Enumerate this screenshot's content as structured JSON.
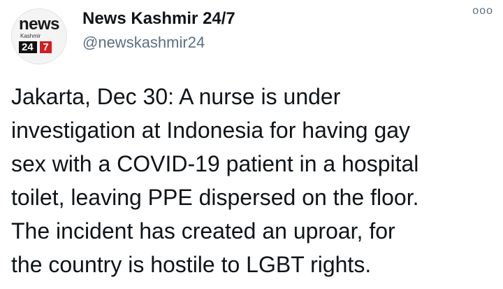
{
  "account": {
    "display_name": "News Kashmir 24/7",
    "handle": "@newskashmir24",
    "avatar": {
      "word": "news",
      "small": "Kashmir",
      "num": "24",
      "seven": "7"
    }
  },
  "menu": {
    "more_icon": "ooo"
  },
  "tweet": {
    "lines": [
      "Jakarta, Dec 30: A nurse is under",
      "investigation at Indonesia for having gay",
      "sex with a COVID-19 patient in a hospital",
      "toilet, leaving PPE dispersed on the floor.",
      "The incident has created an uproar, for",
      "the country is hostile to LGBT rights."
    ]
  },
  "colors": {
    "text": "#0f1419",
    "secondary": "#5b7083",
    "logo_red": "#d11e1e"
  }
}
